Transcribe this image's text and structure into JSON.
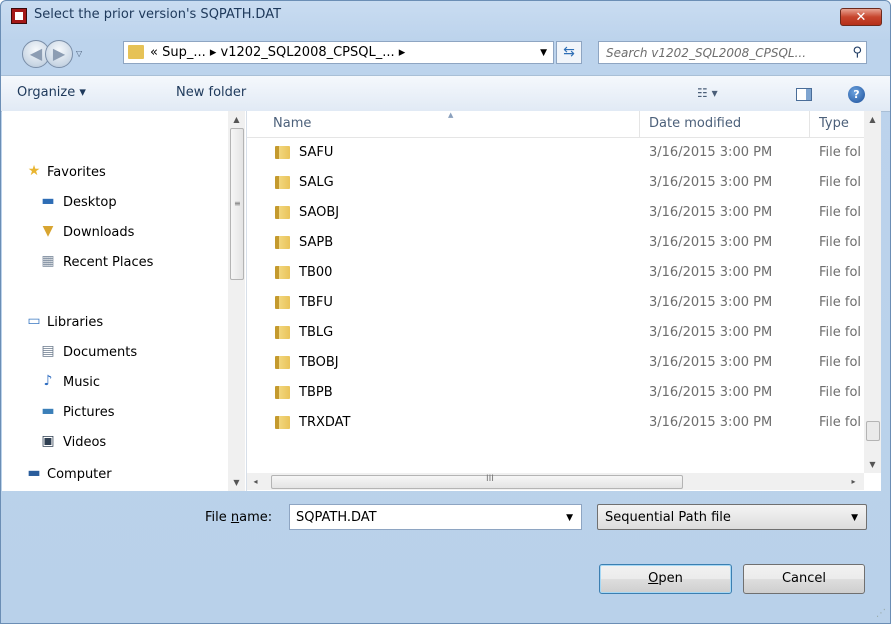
{
  "window": {
    "title": "Select the prior version's SQPATH.DAT",
    "close_glyph": "✕"
  },
  "navigation": {
    "back_glyph": "◀",
    "forward_glyph": "▶",
    "history_glyph": "▽",
    "address_path": "« Sup_... ▸ v1202_SQL2008_CPSQL_... ▸",
    "address_dropdown_glyph": "▼",
    "refresh_glyph": "⇆",
    "search_placeholder": "Search v1202_SQL2008_CPSQL...",
    "search_icon_glyph": "⚲"
  },
  "toolbar": {
    "organize_label": "Organize ▾",
    "new_folder_label": "New folder",
    "views_glyph": "☷ ▾",
    "help_glyph": "?"
  },
  "sidebar": {
    "items": [
      {
        "label": "Favorites",
        "icon": "star-icon",
        "glyph": "★",
        "color": "#e9b530"
      },
      {
        "label": "Desktop",
        "icon": "desktop-icon",
        "glyph": "▬",
        "color": "#2e6db5"
      },
      {
        "label": "Downloads",
        "icon": "downloads-icon",
        "glyph": "▼",
        "color": "#d8a531"
      },
      {
        "label": "Recent Places",
        "icon": "recent-places-icon",
        "glyph": "▦",
        "color": "#7b8a9c"
      },
      {
        "label": "Libraries",
        "icon": "libraries-icon",
        "glyph": "▭",
        "color": "#3a78c2"
      },
      {
        "label": "Documents",
        "icon": "documents-icon",
        "glyph": "▤",
        "color": "#6b7a8c"
      },
      {
        "label": "Music",
        "icon": "music-icon",
        "glyph": "♪",
        "color": "#2d6cc0"
      },
      {
        "label": "Pictures",
        "icon": "pictures-icon",
        "glyph": "▬",
        "color": "#3b7fb8"
      },
      {
        "label": "Videos",
        "icon": "videos-icon",
        "glyph": "▣",
        "color": "#2f3f52"
      },
      {
        "label": "Computer",
        "icon": "computer-icon",
        "glyph": "▬",
        "color": "#2a5d9c"
      }
    ],
    "grip_glyph": "≡",
    "scroll_up_glyph": "▲",
    "scroll_down_glyph": "▼"
  },
  "file_list": {
    "columns": {
      "name": "Name",
      "date": "Date modified",
      "type": "Type"
    },
    "sort_glyph": "▲",
    "rows": [
      {
        "name": "SAFU",
        "date": "3/16/2015 3:00 PM",
        "type": "File fol"
      },
      {
        "name": "SALG",
        "date": "3/16/2015 3:00 PM",
        "type": "File fol"
      },
      {
        "name": "SAOBJ",
        "date": "3/16/2015 3:00 PM",
        "type": "File fol"
      },
      {
        "name": "SAPB",
        "date": "3/16/2015 3:00 PM",
        "type": "File fol"
      },
      {
        "name": "TB00",
        "date": "3/16/2015 3:00 PM",
        "type": "File fol"
      },
      {
        "name": "TBFU",
        "date": "3/16/2015 3:00 PM",
        "type": "File fol"
      },
      {
        "name": "TBLG",
        "date": "3/16/2015 3:00 PM",
        "type": "File fol"
      },
      {
        "name": "TBOBJ",
        "date": "3/16/2015 3:00 PM",
        "type": "File fol"
      },
      {
        "name": "TBPB",
        "date": "3/16/2015 3:00 PM",
        "type": "File fol"
      },
      {
        "name": "TRXDAT",
        "date": "3/16/2015 3:00 PM",
        "type": "File fol"
      }
    ],
    "hscroll_left_glyph": "◂",
    "hscroll_right_glyph": "▸",
    "hscroll_grip_glyph": "III",
    "vscroll_up_glyph": "▲",
    "vscroll_down_glyph": "▼"
  },
  "footer": {
    "file_name_label_pre": "File ",
    "file_name_label_accel": "n",
    "file_name_label_post": "ame:",
    "file_name_value": "SQPATH.DAT",
    "file_name_drop_glyph": "▼",
    "file_type_value": "Sequential Path file",
    "file_type_drop_glyph": "▼",
    "open_accel": "O",
    "open_rest": "pen",
    "cancel_label": "Cancel",
    "resize_glyph": "⋰"
  }
}
